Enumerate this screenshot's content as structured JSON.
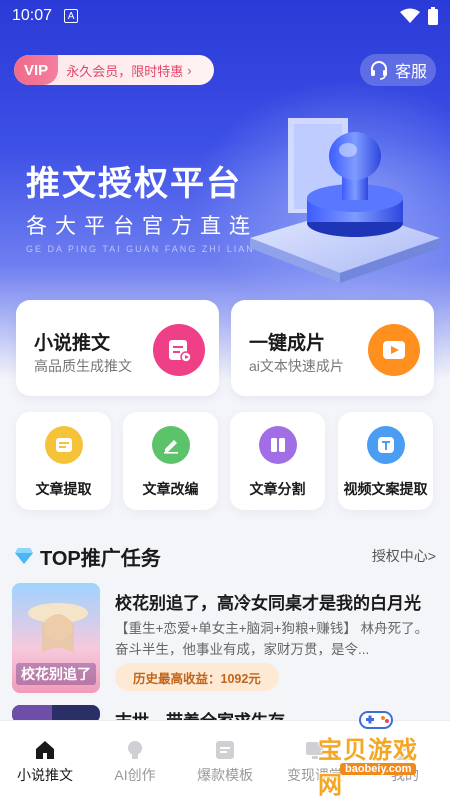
{
  "status_bar": {
    "time": "10:07",
    "notif_glyph": "A"
  },
  "vip_banner": {
    "tag": "VIP",
    "text": "永久会员，限时特惠",
    "arrow": "›"
  },
  "service": {
    "label": "客服",
    "icon": "headset-icon"
  },
  "hero": {
    "title": "推文授权平台",
    "subtitle": "各大平台官方直连",
    "pinyin": "GE DA PING TAI GUAN FANG ZHI LIAN"
  },
  "feature_cards": [
    {
      "title": "小说推文",
      "desc": "高品质生成推文",
      "icon": "document-icon",
      "color": "#ef3f87"
    },
    {
      "title": "一键成片",
      "desc": "ai文本快速成片",
      "icon": "play-icon",
      "color": "#ff8f1f"
    }
  ],
  "tools": [
    {
      "label": "文章提取",
      "icon": "text-lines-icon",
      "color": "#f6c23a"
    },
    {
      "label": "文章改编",
      "icon": "pencil-icon",
      "color": "#5cc36b"
    },
    {
      "label": "文章分割",
      "icon": "book-icon",
      "color": "#a16ee6"
    },
    {
      "label": "视频文案提取",
      "icon": "text-t-icon",
      "color": "#4a9df2"
    }
  ],
  "section": {
    "title": "TOP推广任务",
    "link": "授权中心>"
  },
  "tasks": [
    {
      "title": "校花别追了，高冷女同桌才是我的白月光",
      "desc": "【重生+恋爱+单女主+脑洞+狗粮+赚钱】 林舟死了。 奋斗半生，他事业有成，家财万贯，是令...",
      "earnings": "历史最高收益：1092元",
      "cover_text": "校花别追了"
    },
    {
      "title": "末世，带着全家求生存",
      "desc": "",
      "earnings": "",
      "cover_text": ""
    }
  ],
  "tabs": [
    {
      "label": "小说推文",
      "icon": "home-icon",
      "active": true
    },
    {
      "label": "AI创作",
      "icon": "bulb-icon",
      "active": false
    },
    {
      "label": "爆款模板",
      "icon": "template-icon",
      "active": false
    },
    {
      "label": "变现课堂",
      "icon": "classroom-icon",
      "active": false
    },
    {
      "label": "我的",
      "icon": "profile-icon",
      "active": false
    }
  ],
  "watermark": {
    "text": "宝贝游戏网",
    "url": "baobeiy.com"
  }
}
